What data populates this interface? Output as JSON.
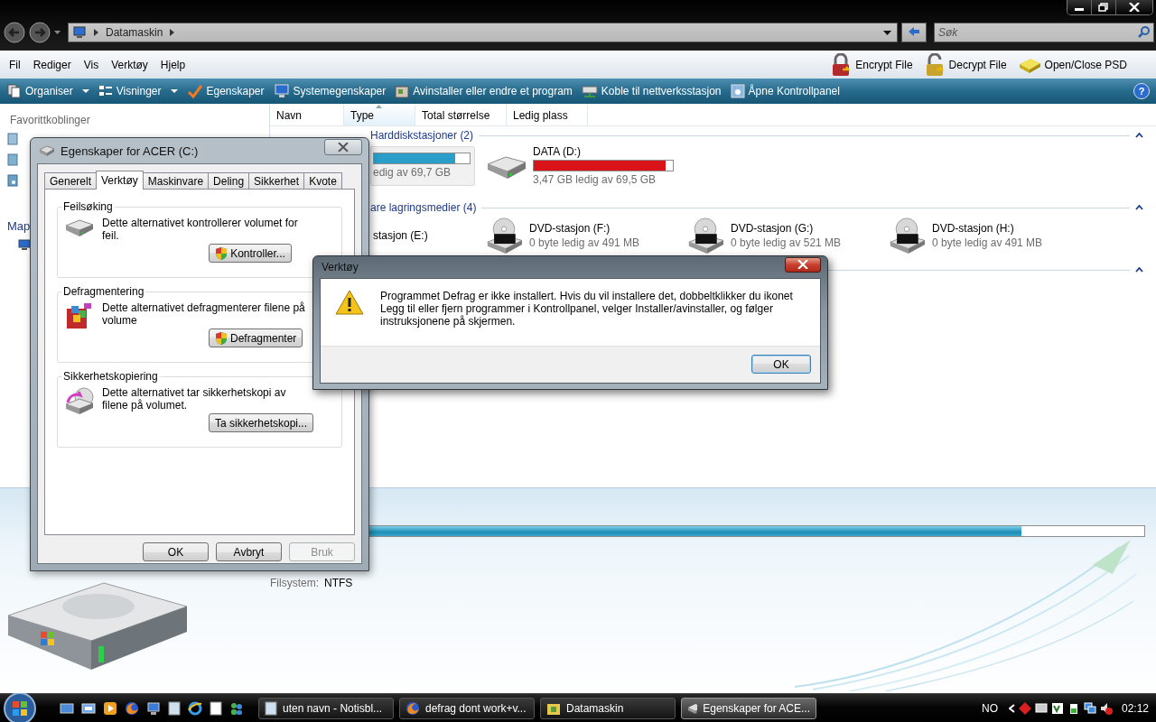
{
  "address": {
    "crumbs": [
      "Datamaskin"
    ]
  },
  "search": {
    "placeholder": "Søk"
  },
  "menu": [
    "Fil",
    "Rediger",
    "Vis",
    "Verktøy",
    "Hjelp"
  ],
  "menu_tools": [
    {
      "label": "Encrypt File",
      "kind": "lock"
    },
    {
      "label": "Decrypt File",
      "kind": "unlock"
    },
    {
      "label": "Open/Close PSD",
      "kind": "drive"
    }
  ],
  "toolbar": [
    {
      "label": "Organiser",
      "kind": "organise",
      "dropdown": true
    },
    {
      "label": "Visninger",
      "kind": "views",
      "dropdown": true
    },
    {
      "label": "Egenskaper",
      "kind": "check",
      "dropdown": false
    },
    {
      "label": "Systemegenskaper",
      "kind": "monitor",
      "dropdown": false
    },
    {
      "label": "Avinstaller eller endre et program",
      "kind": "box",
      "dropdown": false
    },
    {
      "label": "Koble til nettverksstasjon",
      "kind": "network",
      "dropdown": false
    },
    {
      "label": "Åpne Kontrollpanel",
      "kind": "panel",
      "dropdown": false
    }
  ],
  "help_button": "?",
  "sidebar": {
    "title": "Favorittkoblinger",
    "section": "Map"
  },
  "columns": [
    {
      "label": "Navn",
      "sorted": false
    },
    {
      "label": "Type",
      "sorted": true
    },
    {
      "label": "Total størrelse",
      "sorted": false
    },
    {
      "label": "Ledig plass",
      "sorted": false
    }
  ],
  "groups": [
    {
      "title": "Harddiskstasjoner (2)",
      "items": [
        {
          "selected": true,
          "level": 0.85,
          "color": "#2a9ec8",
          "free": "edig av 69,7 GB"
        },
        {
          "kind": "hdd",
          "selected": false,
          "name": "DATA (D:)",
          "level": 0.95,
          "color": "#d8141a",
          "free": "3,47 GB ledig av 69,5 GB"
        }
      ]
    },
    {
      "title": "are lagringsmedier (4)",
      "items": [
        {
          "selected": false,
          "name": "stasjon (E:)"
        },
        {
          "kind": "dvd",
          "selected": false,
          "name": "DVD-stasjon (F:)",
          "free": "0 byte ledig av 491 MB"
        },
        {
          "kind": "dvd",
          "selected": false,
          "name": "DVD-stasjon (G:)",
          "free": "0 byte ledig av 521 MB"
        },
        {
          "kind": "dvd",
          "selected": false,
          "name": "DVD-stasjon (H:)",
          "free": "0 byte ledig av 491 MB"
        }
      ]
    }
  ],
  "details": {
    "level": 0.86,
    "fields": [
      {
        "label": "Filsystem:",
        "value": "NTFS"
      }
    ]
  },
  "properties_dialog": {
    "title": "Egenskaper for ACER (C:)",
    "tabs": [
      {
        "label": "Generelt",
        "selected": false
      },
      {
        "label": "Verktøy",
        "selected": true
      },
      {
        "label": "Maskinvare",
        "selected": false
      },
      {
        "label": "Deling",
        "selected": false
      },
      {
        "label": "Sikkerhet",
        "selected": false
      },
      {
        "label": "Kvote",
        "selected": false
      }
    ],
    "sections": [
      {
        "title": "Feilsøking",
        "kind": "disk",
        "text": "Dette alternativet kontrollerer volumet for feil.",
        "button": "Kontroller...",
        "shield": true
      },
      {
        "title": "Defragmentering",
        "kind": "defrag",
        "text": "Dette alternativet defragmenterer filene på volume",
        "button": "Defragmenter",
        "shield": true
      },
      {
        "title": "Sikkerhetskopiering",
        "kind": "backup",
        "text": "Dette alternativet tar sikkerhetskopi av filene på volumet.",
        "button": "Ta sikkerhetskopi...",
        "shield": false
      }
    ],
    "buttons": [
      {
        "label": "OK",
        "disabled": false
      },
      {
        "label": "Avbryt",
        "disabled": false
      },
      {
        "label": "Bruk",
        "disabled": true
      }
    ]
  },
  "message_box": {
    "title": "Verktøy",
    "text": "Programmet Defrag er ikke installert. Hvis du vil installere det, dobbeltklikker du ikonet Legg til eller fjern programmer i Kontrollpanel, velger Installer/avinstaller, og følger instruksjonene på skjermen.",
    "button": "OK"
  },
  "taskbar": {
    "tasks": [
      {
        "label": "uten navn - Notisbl...",
        "kind": "notepad",
        "selected": false
      },
      {
        "label": "defrag dont work+v...",
        "kind": "browser",
        "selected": false
      },
      {
        "label": "Datamaskin",
        "kind": "folder",
        "selected": false
      },
      {
        "label": "Egenskaper for ACE...",
        "kind": "drive",
        "selected": true
      }
    ],
    "language": "NO",
    "clock": "02:12"
  }
}
